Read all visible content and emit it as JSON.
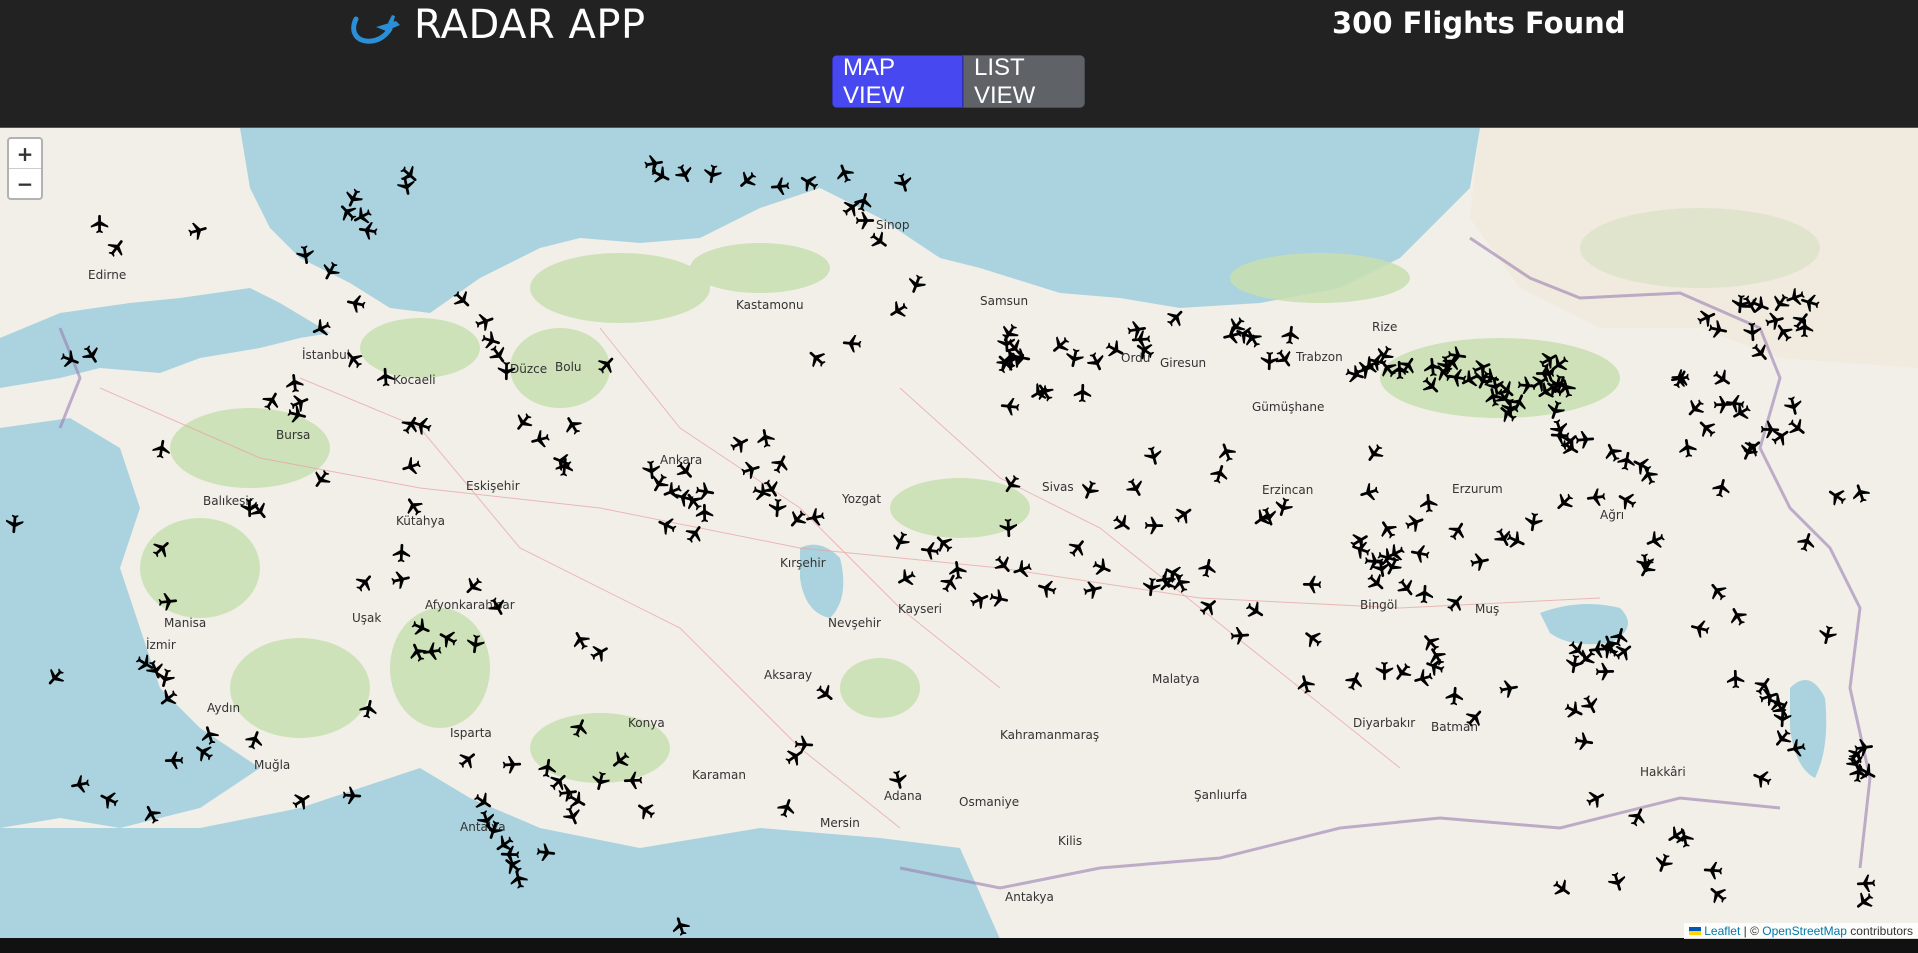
{
  "app": {
    "title": "RADAR APP",
    "flight_count_text": "300 Flights Found",
    "logo_icon": "plane-swoosh-icon"
  },
  "view_toggle": {
    "map_label": "MAP VIEW",
    "list_label": "LIST VIEW",
    "selected": "MAP VIEW"
  },
  "map": {
    "zoom_in": "+",
    "zoom_out": "−",
    "attribution": {
      "leaflet": "Leaflet",
      "separator": " | © ",
      "osm": "OpenStreetMap",
      "suffix": " contributors"
    },
    "colors": {
      "sea": "#aad3df",
      "land": "#f2efe9",
      "forest": "#c8dfb0",
      "border": "#9a7fb0",
      "plane": "#000000",
      "accent": "#4848f0"
    },
    "cities": [
      "Edirne",
      "İstanbul",
      "Kocaeli",
      "Bolu",
      "Düzce",
      "Sinop",
      "Kastamonu",
      "Samsun",
      "Ordu",
      "Giresun",
      "Rize",
      "Trabzon",
      "Ankara",
      "Eskişehir",
      "Kütahya",
      "Balıkesir",
      "Manisa",
      "İzmir",
      "Aydın",
      "Muğla",
      "Isparta",
      "Antalya",
      "Konya",
      "Aksaray",
      "Karaman",
      "Mersin",
      "Adana",
      "Osmaniye",
      "Kayseri",
      "Sivas",
      "Yozgat",
      "Kırşehir",
      "Nevşehir",
      "Malatya",
      "Kahramanmaraş",
      "Şanlıurfa",
      "Diyarbakır",
      "Batman",
      "Bingöl",
      "Muş",
      "Erzurum",
      "Ağrı",
      "Erzincan",
      "Gümüşhane",
      "Afyonkarahisar",
      "Uşak",
      "Bursa",
      "Kilis",
      "Antakya",
      "Hakkâri"
    ]
  }
}
